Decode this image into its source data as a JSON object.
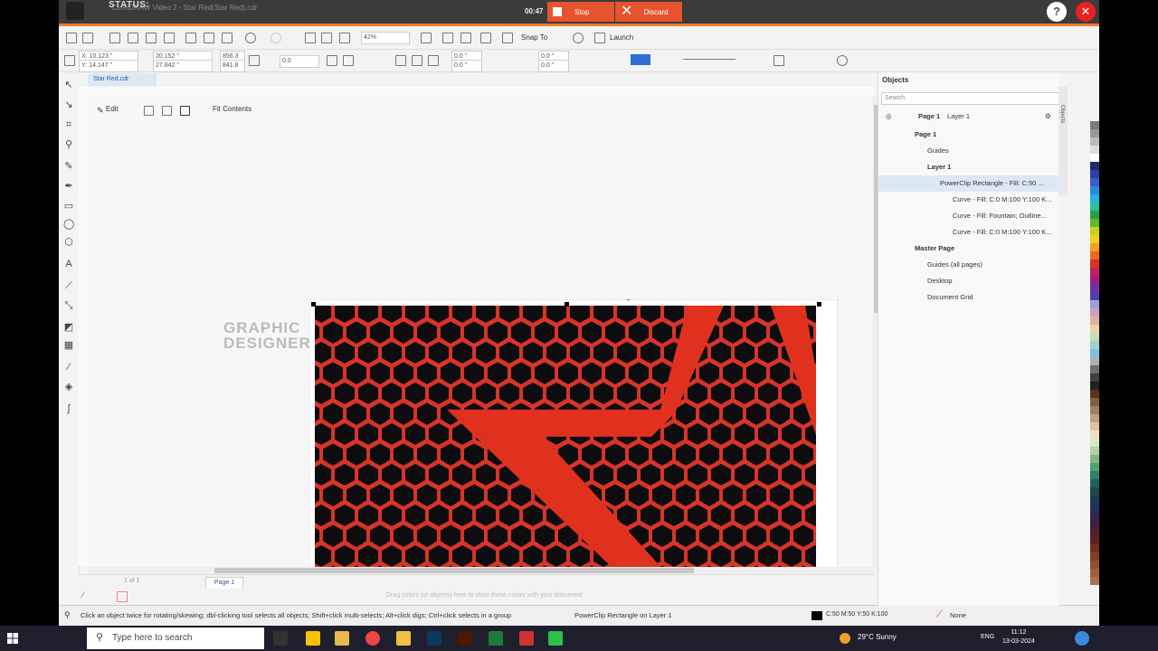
{
  "recorder": {
    "status_label": "STATUS:",
    "window_title": "CorelDRAW Video 2 - Star Red(Star Red).cdr",
    "timer": "00:47",
    "stop_label": "Stop",
    "discard_label": "Discard",
    "help_symbol": "?",
    "close_symbol": "✕"
  },
  "toolbar": {
    "zoom": "42%",
    "snap_label": "Snap To",
    "launch_label": "Launch",
    "x": "X: 10.123 \"",
    "y": "Y: 14.147 \"",
    "w": "20.152 \"",
    "h": "27.842 \"",
    "sx": "856.3",
    "sy": "841.8",
    "angle": "0.0",
    "nudge1": "0.0 \"",
    "nudge2": "0.0 \"",
    "nudge3": "0.0 \"",
    "nudge4": "0.0 \""
  },
  "document": {
    "tab_label": "Star Red.cdr",
    "edit_label": "Edit",
    "fit_label": "Fit Contents",
    "page_tab": "Page 1",
    "page_nav": "1 of 1",
    "drag_hint": "Drag colors (or objects) here to store these colors with your document"
  },
  "watermark": {
    "line1": "GRAPHIC",
    "line2": "DESIGNER"
  },
  "objects_docker": {
    "title": "Objects",
    "search_placeholder": "Search",
    "current_page": "Page 1",
    "current_layer": "Layer 1",
    "rows": [
      {
        "label": "Page 1",
        "indent": 0
      },
      {
        "label": "Guides",
        "indent": 1
      },
      {
        "label": "Layer 1",
        "indent": 1
      },
      {
        "label": "PowerClip Rectangle - Fill: C:50 ...",
        "indent": 2,
        "selected": true
      },
      {
        "label": "Curve - Fill: C:0 M:100 Y:100 K...",
        "indent": 3
      },
      {
        "label": "Curve - Fill: Fountain; Outline...",
        "indent": 3
      },
      {
        "label": "Curve - Fill: C:0 M:100 Y:100 K...",
        "indent": 3
      },
      {
        "label": "Master Page",
        "indent": 0
      },
      {
        "label": "Guides (all pages)",
        "indent": 1
      },
      {
        "label": "Desktop",
        "indent": 1
      },
      {
        "label": "Document Grid",
        "indent": 1
      }
    ],
    "side_tabs": "Objects"
  },
  "statusbar": {
    "message": "Click an object twice for rotating/skewing; dbl-clicking tool selects all objects; Shift+click multi-selects; Alt+click digs; Ctrl+click selects in a group",
    "object_info": "PowerClip Rectangle on Layer 1",
    "fill_info": "C:50 M:50 Y:50 K:100",
    "outline_info": "None"
  },
  "taskbar": {
    "search_placeholder": "Type here to search",
    "weather": "29°C  Sunny",
    "language": "ENG",
    "time": "11:12",
    "date": "13-03-2024"
  },
  "colors": {
    "accent_orange": "#ef7a2f",
    "record_red": "#e8532f",
    "star_red": "#e0311f",
    "hex_bg": "#0d0d0f",
    "selection_blue": "#dde8f5"
  }
}
